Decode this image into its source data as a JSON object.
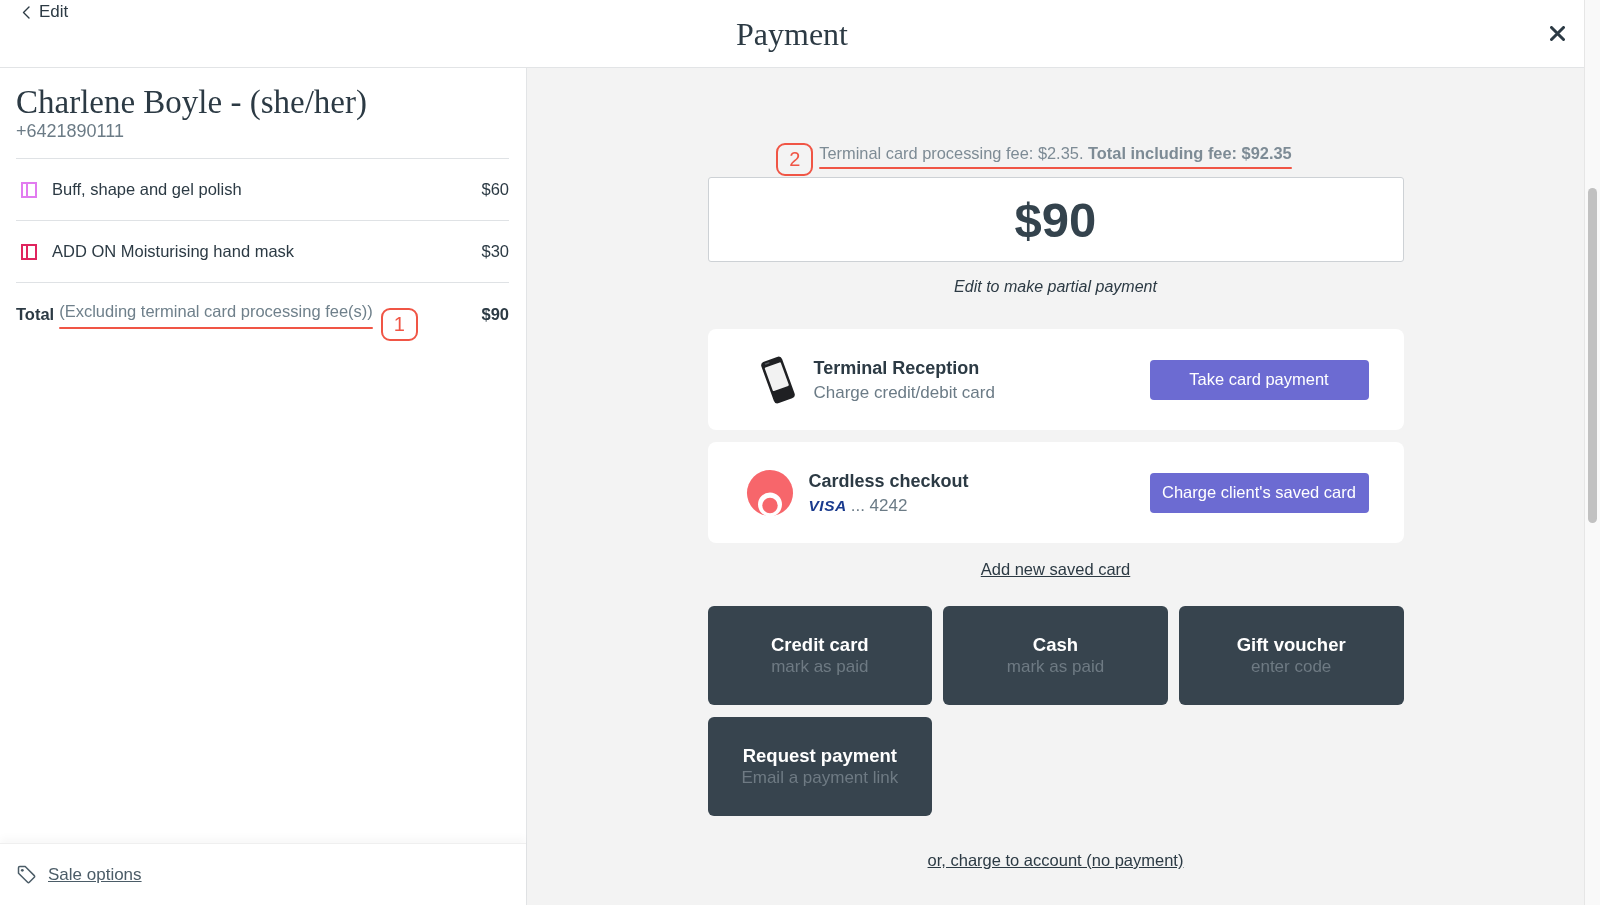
{
  "header": {
    "back_link": "Edit",
    "title": "Payment"
  },
  "client": {
    "name": "Charlene Boyle - (she/her)",
    "phone": "+6421890111"
  },
  "items": [
    {
      "name": "Buff, shape and gel polish",
      "price": "$60",
      "color": "#e27bf0"
    },
    {
      "name": "ADD ON Moisturising hand mask",
      "price": "$30",
      "color": "#e0245e"
    }
  ],
  "total": {
    "label": "Total",
    "note": "(Excluding terminal card processing fee(s))",
    "amount": "$90",
    "annotation": {
      "label": "1"
    }
  },
  "sale_options": "Sale options",
  "fee_notice": {
    "text": "Terminal card processing fee: $2.35. **Total including fee: $92.35**",
    "annotation": {
      "label": "2"
    }
  },
  "amount_field": {
    "value": "$90",
    "hint": "Edit to make partial payment"
  },
  "payment_methods": [
    {
      "kind": "terminal",
      "title": "Terminal Reception",
      "subtitle": "Charge credit/debit card",
      "button": "Take card payment"
    },
    {
      "kind": "saved_card",
      "title": "Cardless checkout",
      "card_brand": "VISA",
      "card_number": "... 4242",
      "button": "Charge client's saved card"
    }
  ],
  "add_card_link": "Add new saved card",
  "tiles": [
    {
      "title": "Credit card",
      "subtitle": "mark as paid"
    },
    {
      "title": "Cash",
      "subtitle": "mark as paid"
    },
    {
      "title": "Gift voucher",
      "subtitle": "enter code"
    },
    {
      "title": "Request payment",
      "subtitle": "Email a payment link"
    }
  ],
  "charge_to_account_link": "or, charge to account (no payment)"
}
